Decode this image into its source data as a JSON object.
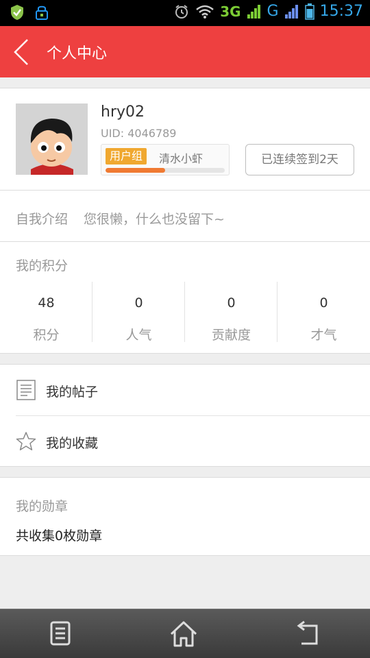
{
  "status_bar": {
    "network_3g": "3G",
    "network_g": "G",
    "time": "15:37"
  },
  "header": {
    "title": "个人中心"
  },
  "profile": {
    "username": "hry02",
    "uid": "UID: 4046789",
    "group_tag": "用户组",
    "group_name": "清水小虾",
    "level_progress": 0.5,
    "checkin_label": "已连续签到2天"
  },
  "intro": {
    "label": "自我介绍",
    "text": "您很懒，什么也没留下~"
  },
  "points": {
    "title": "我的积分",
    "stats": [
      {
        "value": "48",
        "label": "积分"
      },
      {
        "value": "0",
        "label": "人气"
      },
      {
        "value": "0",
        "label": "贡献度"
      },
      {
        "value": "0",
        "label": "才气"
      }
    ]
  },
  "menu": {
    "items": [
      {
        "label": "我的帖子",
        "icon": "document-icon"
      },
      {
        "label": "我的收藏",
        "icon": "star-icon"
      }
    ]
  },
  "medals": {
    "title": "我的勋章",
    "summary": "共收集0枚勋章"
  },
  "colors": {
    "header_red": "#ee4040",
    "tag_orange": "#f0a830",
    "progress_orange": "#f07a32"
  }
}
